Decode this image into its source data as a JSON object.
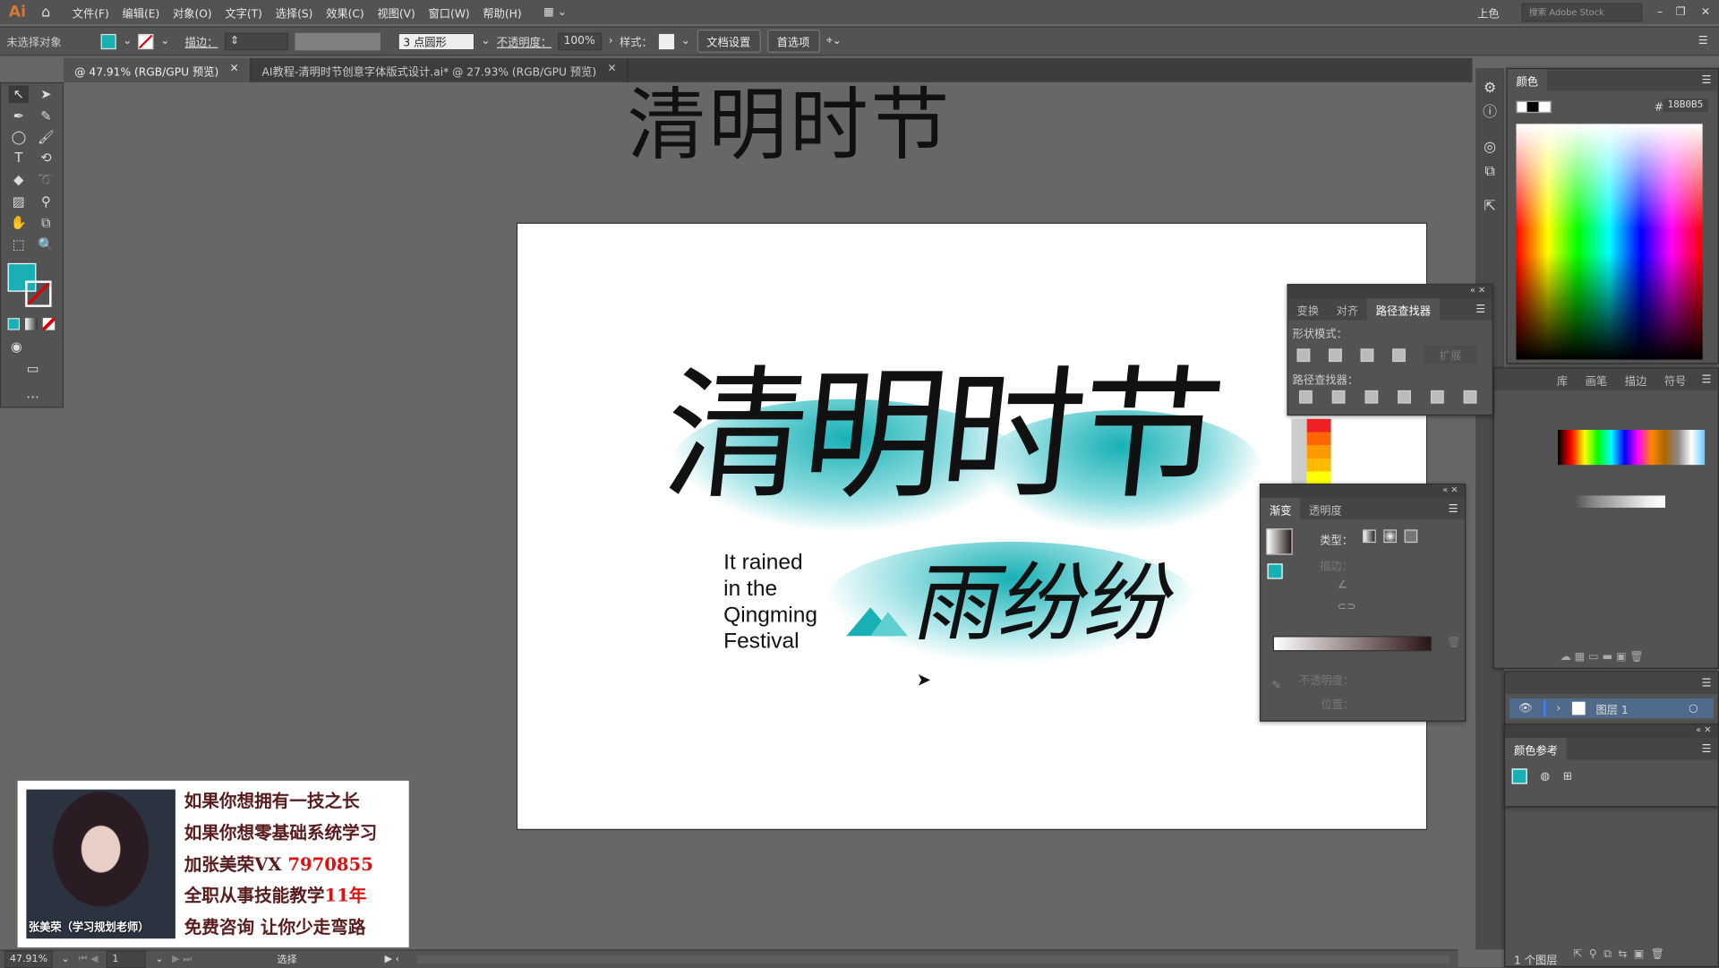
{
  "app": {
    "logo": "Ai",
    "workspace": "上色",
    "search_placeholder": "搜索 Adobe Stock"
  },
  "menu": [
    "文件(F)",
    "编辑(E)",
    "对象(O)",
    "文字(T)",
    "选择(S)",
    "效果(C)",
    "视图(V)",
    "窗口(W)",
    "帮助(H)"
  ],
  "control": {
    "selection": "未选择对象",
    "stroke_label": "描边：",
    "brush": "3 点圆形",
    "opacity_label": "不透明度：",
    "opacity": "100%",
    "style_label": "样式：",
    "doc_setup": "文档设置",
    "prefs": "首选项",
    "fill_color": "#18B0B5"
  },
  "tabs": [
    {
      "label": "@ 47.91% (RGB/GPU 预览)",
      "active": true
    },
    {
      "label": "AI教程-清明时节创意字体版式设计.ai* @ 27.93% (RGB/GPU 预览)",
      "active": false
    }
  ],
  "artwork": {
    "title": "清明时节",
    "sub": "雨纷纷",
    "english": [
      "It rained",
      "in the",
      "Qingming",
      "Festival"
    ],
    "accent": "#18B0B5"
  },
  "color_panel": {
    "title": "颜色",
    "hex_label": "#",
    "hex": "18B0B5"
  },
  "pathfinder": {
    "tabs": [
      "变换",
      "对齐",
      "路径查找器"
    ],
    "shape_modes": "形状模式：",
    "expand": "扩展",
    "pathfinders": "路径查找器："
  },
  "swatch_tabs": [
    "库",
    "画笔",
    "描边",
    "符号"
  ],
  "gradient": {
    "tabs": [
      "渐变",
      "透明度"
    ],
    "type_label": "类型：",
    "stroke_label": "描边：",
    "opacity_label": "不透明度：",
    "position_label": "位置："
  },
  "layers": {
    "name": "图层 1",
    "count": "1 个图层"
  },
  "color_guide": {
    "title": "颜色参考"
  },
  "ad": {
    "caption": "张美荣（学习规划老师）",
    "lines": [
      [
        "如果你想拥有一技之长",
        ""
      ],
      [
        "如果你想零基础系统学习",
        ""
      ],
      [
        "加张美荣VX ",
        "7970855"
      ],
      [
        "全职从事技能教学",
        "11年"
      ],
      [
        "免费咨询 让你少走弯路",
        ""
      ]
    ]
  },
  "status": {
    "zoom": "47.91%",
    "page": "1",
    "mode": "选择"
  }
}
